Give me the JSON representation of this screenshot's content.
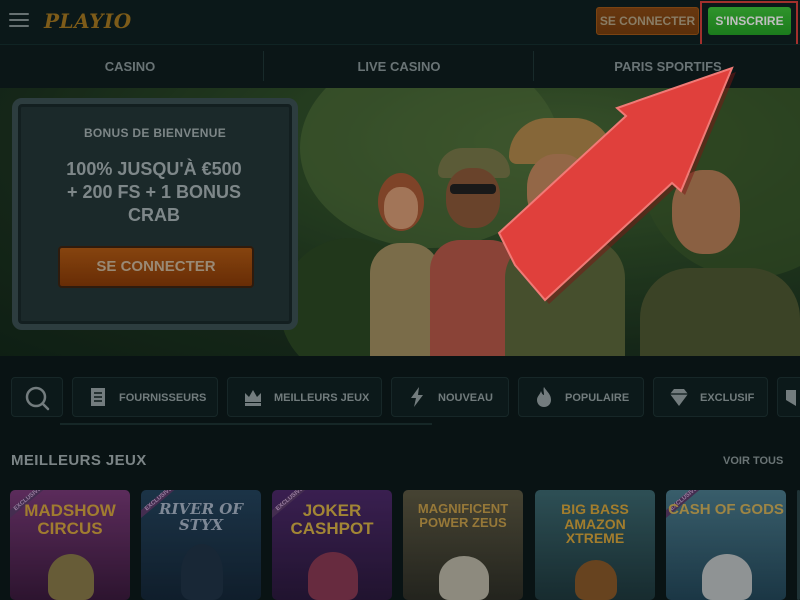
{
  "header": {
    "logo": "PLAYIO",
    "login_label": "SE CONNECTER",
    "signup_label": "S'INSCRIRE"
  },
  "nav": {
    "items": [
      {
        "label": "CASINO"
      },
      {
        "label": "LIVE CASINO"
      },
      {
        "label": "PARIS SPORTIFS"
      }
    ]
  },
  "hero": {
    "bonus_title": "BONUS DE BIENVENUE",
    "offer_line1": "100% JUSQU'À €500",
    "offer_line2": "+ 200 FS + 1 BONUS",
    "offer_line3": "CRAB",
    "cta_label": "SE CONNECTER"
  },
  "filters": {
    "items": [
      {
        "label": "FOURNISSEURS",
        "icon": "document-icon"
      },
      {
        "label": "MEILLEURS JEUX",
        "icon": "crown-icon"
      },
      {
        "label": "NOUVEAU",
        "icon": "lightning-icon"
      },
      {
        "label": "POPULAIRE",
        "icon": "flame-icon"
      },
      {
        "label": "EXCLUSIF",
        "icon": "diamond-icon"
      }
    ]
  },
  "games": {
    "section_title": "MEILLEURS JEUX",
    "view_all": "VOIR TOUS",
    "items": [
      {
        "title": "MADSHOW CIRCUS",
        "badge": "EXCLUSIVE"
      },
      {
        "title": "RIVER OF STYX",
        "badge": "EXCLUSIVE"
      },
      {
        "title": "JOKER CASHPOT",
        "badge": "EXCLUSIVE"
      },
      {
        "title": "MAGNIFICENT POWER ZEUS",
        "badge": ""
      },
      {
        "title": "BIG BASS AMAZON XTREME",
        "badge": ""
      },
      {
        "title": "CASH OF GODS",
        "badge": "EXCLUSIVE"
      }
    ]
  },
  "colors": {
    "background": "#0c1a1b",
    "signup_green": "#2fb52f",
    "login_orange": "#8b4a15",
    "annotation_red": "#d8403c"
  }
}
